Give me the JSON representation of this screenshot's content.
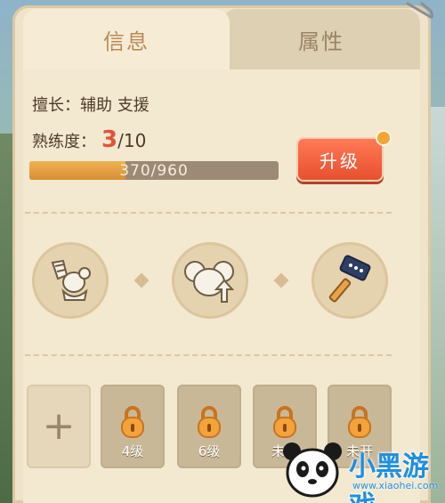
{
  "tabs": [
    {
      "label": "信息",
      "active": true
    },
    {
      "label": "属性",
      "active": false
    }
  ],
  "info": {
    "specialty": "擅长：辅助 支援",
    "proficiency_label": "熟练度：",
    "proficiency_current": "3",
    "proficiency_sep": "/",
    "proficiency_max": "10",
    "xp_text": "370/960",
    "xp_progress_fraction": 0.385,
    "upgrade_label": "升级",
    "has_notification": true
  },
  "skills": [
    {
      "icon": "mouse-horn-icon"
    },
    {
      "icon": "mouse-upgrade-icon"
    },
    {
      "icon": "hammer-icon"
    }
  ],
  "slots": {
    "add_symbol": "+",
    "locked": [
      {
        "label": "4级"
      },
      {
        "label": "6级"
      },
      {
        "label": "未开"
      },
      {
        "label": "未开"
      }
    ]
  },
  "watermark": {
    "text": "小黑游戏",
    "url": "www.xiaohei.com"
  },
  "colors": {
    "panel": "#efe3c9",
    "upgrade_button": "#e8502f",
    "proficiency_current": "#e2533a",
    "xp_fill": "#d88f34",
    "notification_dot": "#f5a534"
  }
}
